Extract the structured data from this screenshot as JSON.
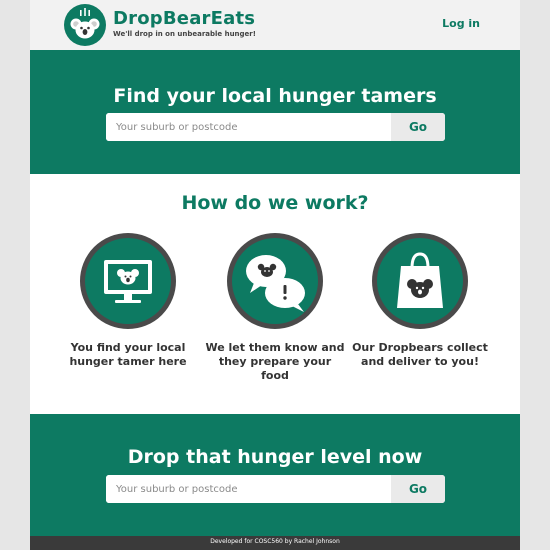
{
  "header": {
    "brand": "DropBearEats",
    "tagline": "We'll drop in on unbearable hunger!",
    "login_label": "Log in",
    "logo_icon": "koala-logo-icon"
  },
  "hero_top": {
    "title": "Find your local hunger tamers",
    "search_placeholder": "Your suburb or postcode",
    "search_value": "",
    "go_label": "Go"
  },
  "how": {
    "title": "How do we work?",
    "steps": [
      {
        "icon": "computer-koala-icon",
        "text": "You find your local hunger tamer here"
      },
      {
        "icon": "chat-bubbles-icon",
        "text": "We let them know and they prepare your food"
      },
      {
        "icon": "shopping-bag-icon",
        "text": "Our Dropbears collect and deliver to you!"
      }
    ]
  },
  "hero_bottom": {
    "title": "Drop that hunger level now",
    "search_placeholder": "Your suburb or postcode",
    "search_value": "",
    "go_label": "Go"
  },
  "footer": {
    "text": "Developed for COSC560 by Rachel Johnson"
  },
  "colors": {
    "brand_green": "#0d7a62",
    "circle_border": "#4a4a4a",
    "footer_bg": "#3a3a3a",
    "page_bg": "#e6e6e6"
  }
}
